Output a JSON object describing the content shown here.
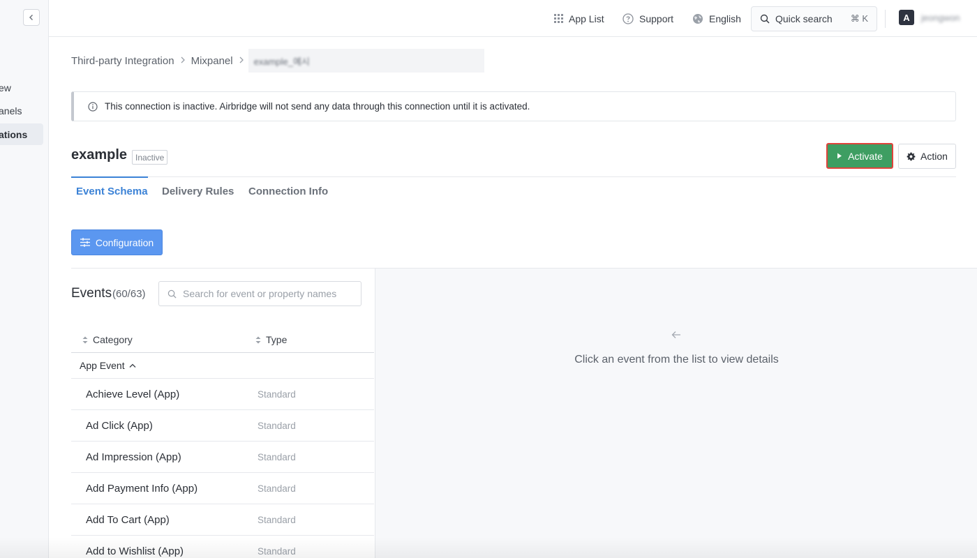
{
  "sidebar": {
    "items": [
      {
        "label": "ew"
      },
      {
        "label": "anels"
      },
      {
        "label": "ations"
      }
    ]
  },
  "topbar": {
    "app_list": "App List",
    "support": "Support",
    "language": "English",
    "quick_search": "Quick search",
    "shortcut": "⌘ K",
    "avatar_letter": "A",
    "username": "jeongwon"
  },
  "breadcrumb": {
    "items": [
      "Third-party Integration",
      "Mixpanel",
      "example_예시"
    ]
  },
  "notice": {
    "text": "This connection is inactive. Airbridge will not send any data through this connection until it is activated."
  },
  "header": {
    "title": "example",
    "status": "Inactive",
    "activate_label": "Activate",
    "action_label": "Action"
  },
  "tabs": [
    {
      "label": "Event Schema",
      "active": true
    },
    {
      "label": "Delivery Rules",
      "active": false
    },
    {
      "label": "Connection Info",
      "active": false
    }
  ],
  "configuration_label": "Configuration",
  "events": {
    "title": "Events",
    "count": "(60/63)",
    "search_placeholder": "Search for event or property names",
    "columns": {
      "category": "Category",
      "type": "Type"
    },
    "group": "App Event",
    "rows": [
      {
        "name": "Achieve Level (App)",
        "type": "Standard"
      },
      {
        "name": "Ad Click (App)",
        "type": "Standard"
      },
      {
        "name": "Ad Impression (App)",
        "type": "Standard"
      },
      {
        "name": "Add Payment Info (App)",
        "type": "Standard"
      },
      {
        "name": "Add To Cart (App)",
        "type": "Standard"
      },
      {
        "name": "Add to Wishlist (App)",
        "type": "Standard"
      }
    ]
  },
  "detail": {
    "empty_text": "Click an event from the list to view details"
  },
  "colors": {
    "accent": "#3b82d6",
    "activate": "#3e9e62",
    "config": "#5b97f0"
  }
}
